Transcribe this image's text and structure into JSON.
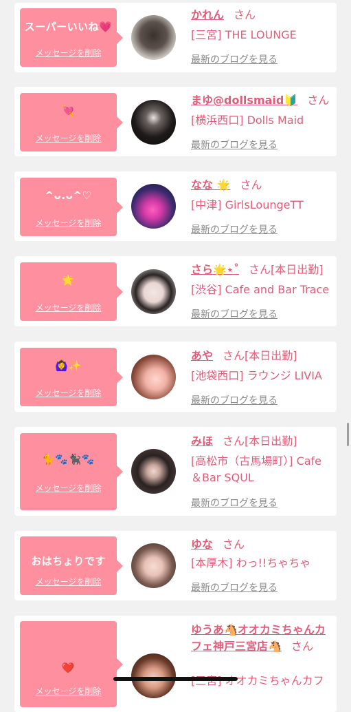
{
  "delete_label": "メッセージを削除",
  "blog_label": "最新のブログを見る",
  "san_label": "さん",
  "colors": {
    "accent": "#e35b78",
    "bubble": "#fe8f9f",
    "background": "#f1f1f1"
  },
  "items": [
    {
      "message": "スーパーいいね💗",
      "name": "かれん",
      "status": "",
      "shop": "[三宮] THE LOUNGE"
    },
    {
      "message": "💘",
      "name": "まゆ@dollsmaid🔰",
      "status": "",
      "shop": "[横浜西口] Dolls Maid"
    },
    {
      "message": "^ᴗ.ᴗ^♡",
      "name": "なな 🌟",
      "status": "",
      "shop": "[中津] GirlsLoungeTT"
    },
    {
      "message": "🌟",
      "name": "さら🌟⋆˚",
      "status": "[本日出勤]",
      "shop": "[渋谷] Cafe and Bar Trace"
    },
    {
      "message": "🙆‍♀️✨",
      "name": "あや",
      "status": "[本日出勤]",
      "shop": "[池袋西口] ラウンジ LIVIA"
    },
    {
      "message": "🐈🐾🐈‍⬛🐾",
      "name": "みほ",
      "status": "[本日出勤]",
      "shop": "[高松市（古馬場町）] Cafe＆Bar SQUL"
    },
    {
      "message": "おはちょりです",
      "name": "ゆな",
      "status": "",
      "shop": "[本厚木] わっ!!ちゃちゃ"
    },
    {
      "message": "❤️",
      "name": "ゆうあ🐴オオカミちゃんカフェ神戸三宮店🐴",
      "status": "",
      "shop": "[三宮] オオカミちゃんカフ"
    }
  ]
}
